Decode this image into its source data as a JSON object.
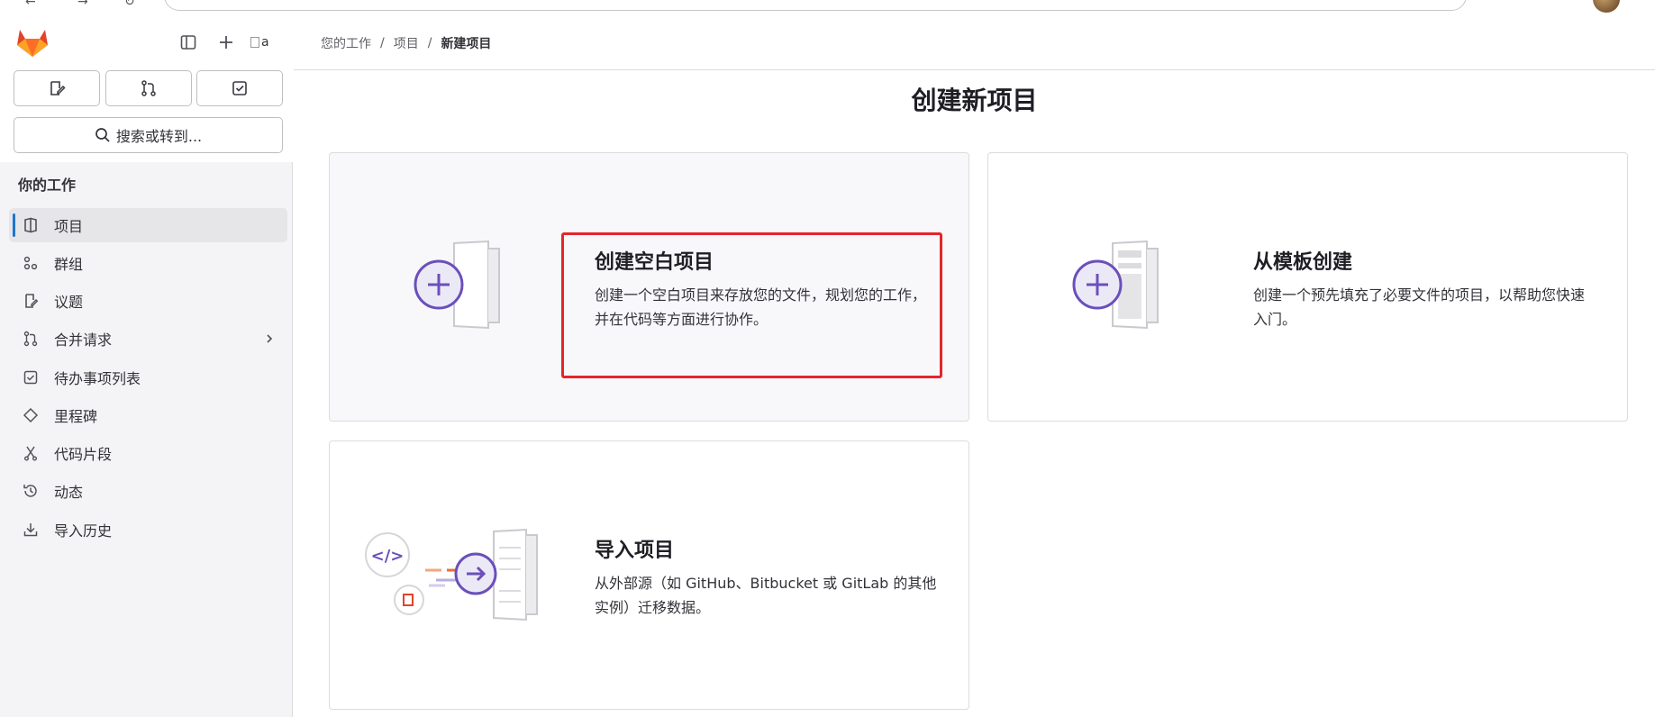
{
  "sidebar": {
    "user_avatar_alt": "a",
    "search_label": "搜索或转到...",
    "section_title": "你的工作",
    "items": [
      {
        "label": "项目",
        "icon": "project-icon",
        "active": true
      },
      {
        "label": "群组",
        "icon": "group-icon"
      },
      {
        "label": "议题",
        "icon": "issues-icon"
      },
      {
        "label": "合并请求",
        "icon": "merge-request-icon",
        "has_chevron": true
      },
      {
        "label": "待办事项列表",
        "icon": "todo-icon"
      },
      {
        "label": "里程碑",
        "icon": "milestone-icon"
      },
      {
        "label": "代码片段",
        "icon": "snippet-icon"
      },
      {
        "label": "动态",
        "icon": "activity-icon"
      },
      {
        "label": "导入历史",
        "icon": "import-history-icon"
      }
    ]
  },
  "breadcrumb": {
    "items": [
      "您的工作",
      "项目",
      "新建项目"
    ],
    "separator": "/"
  },
  "page": {
    "title": "创建新项目"
  },
  "cards": {
    "blank": {
      "title": "创建空白项目",
      "desc_line1": "创建一个空白项目来存放您的文件，规划您的工作，",
      "desc_line2": "并在代码等方面进行协作。"
    },
    "template": {
      "title": "从模板创建",
      "desc_line1": "创建一个预先填充了必要文件的项目，以帮助您快速",
      "desc_line2": "入门。"
    },
    "import": {
      "title": "导入项目",
      "desc_line1": "从外部源（如 GitHub、Bitbucket 或 GitLab 的其他",
      "desc_line2": "实例）迁移数据。"
    }
  },
  "colors": {
    "accent_purple": "#6b4fbb",
    "highlight_red": "#e3262b",
    "active_bar": "#1f75cb"
  }
}
